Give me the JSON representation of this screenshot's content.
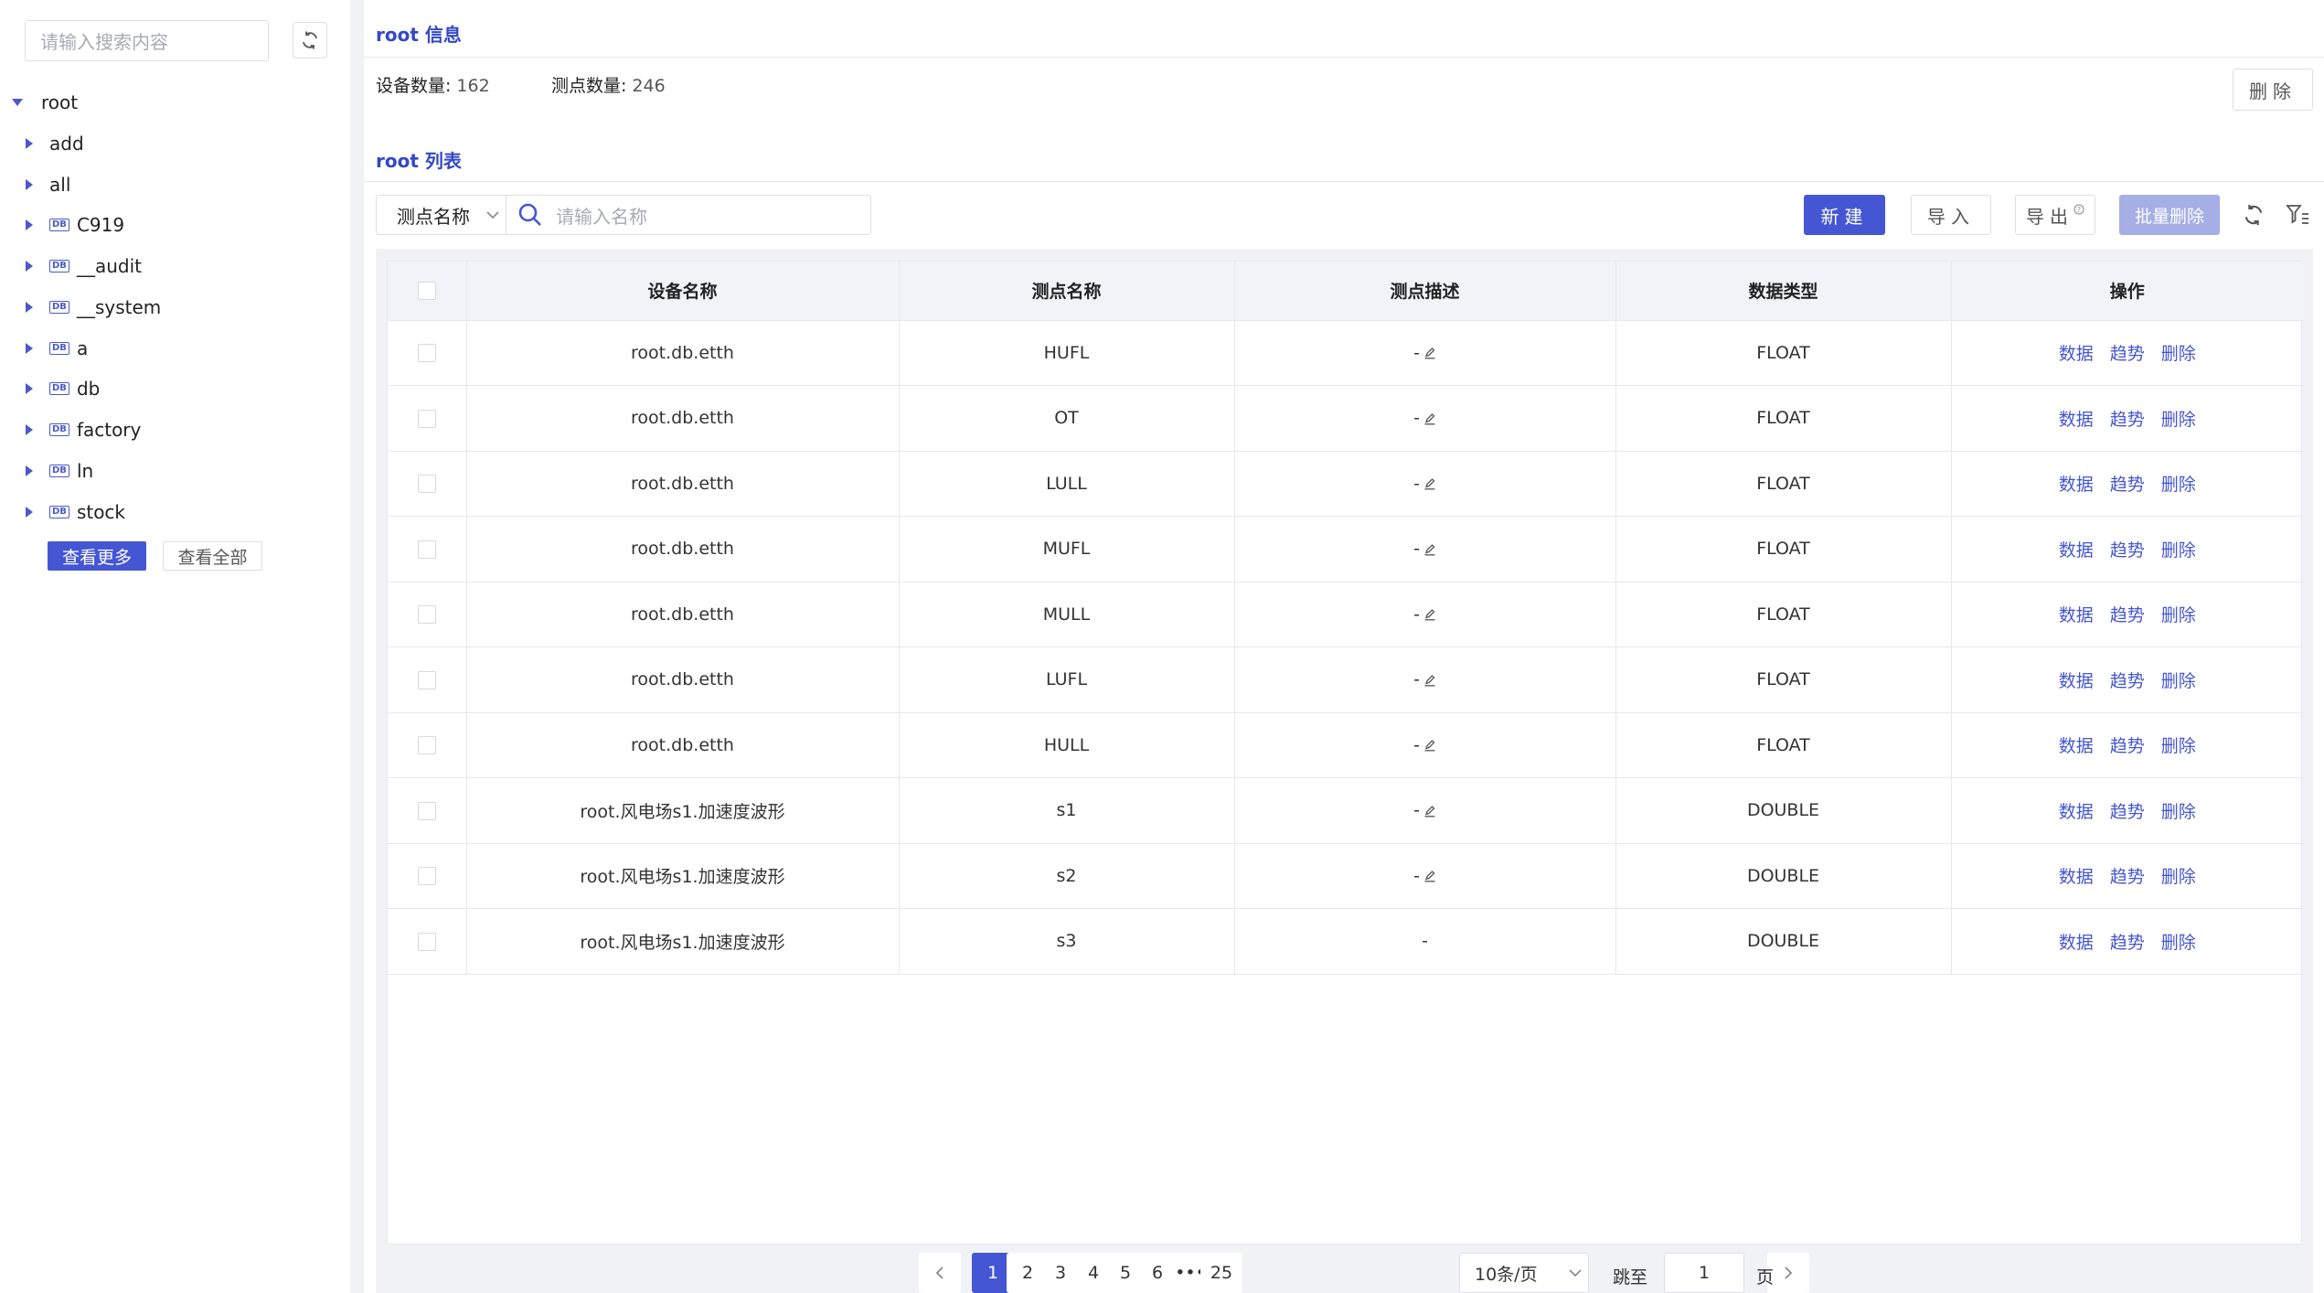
{
  "sidebar": {
    "search_placeholder": "请输入搜索内容",
    "tree": [
      {
        "label": "root",
        "expanded": true,
        "level": 0,
        "db": false
      },
      {
        "label": "add",
        "expanded": false,
        "level": 1,
        "db": false
      },
      {
        "label": "all",
        "expanded": false,
        "level": 1,
        "db": false
      },
      {
        "label": "C919",
        "expanded": false,
        "level": 1,
        "db": true
      },
      {
        "label": "__audit",
        "expanded": false,
        "level": 1,
        "db": true
      },
      {
        "label": "__system",
        "expanded": false,
        "level": 1,
        "db": true
      },
      {
        "label": "a",
        "expanded": false,
        "level": 1,
        "db": true
      },
      {
        "label": "db",
        "expanded": false,
        "level": 1,
        "db": true
      },
      {
        "label": "factory",
        "expanded": false,
        "level": 1,
        "db": true
      },
      {
        "label": "ln",
        "expanded": false,
        "level": 1,
        "db": true
      },
      {
        "label": "stock",
        "expanded": false,
        "level": 1,
        "db": true
      }
    ],
    "db_badge": "DB",
    "more_label": "查看更多",
    "all_label": "查看全部"
  },
  "info": {
    "title": "root 信息",
    "device_label": "设备数量:",
    "device_count": "162",
    "point_label": "测点数量:",
    "point_count": "246",
    "delete_label": "删除"
  },
  "list": {
    "title": "root 列表",
    "filter_select": "测点名称",
    "filter_placeholder": "请输入名称",
    "new_label": "新建",
    "import_label": "导入",
    "export_label": "导出",
    "batch_delete_label": "批量删除",
    "columns": [
      "设备名称",
      "测点名称",
      "测点描述",
      "数据类型",
      "操作"
    ],
    "rows": [
      {
        "device": "root.db.etth",
        "point": "HUFL",
        "desc": "-",
        "type": "FLOAT",
        "editable": true
      },
      {
        "device": "root.db.etth",
        "point": "OT",
        "desc": "-",
        "type": "FLOAT",
        "editable": true
      },
      {
        "device": "root.db.etth",
        "point": "LULL",
        "desc": "-",
        "type": "FLOAT",
        "editable": true
      },
      {
        "device": "root.db.etth",
        "point": "MUFL",
        "desc": "-",
        "type": "FLOAT",
        "editable": true
      },
      {
        "device": "root.db.etth",
        "point": "MULL",
        "desc": "-",
        "type": "FLOAT",
        "editable": true
      },
      {
        "device": "root.db.etth",
        "point": "LUFL",
        "desc": "-",
        "type": "FLOAT",
        "editable": true
      },
      {
        "device": "root.db.etth",
        "point": "HULL",
        "desc": "-",
        "type": "FLOAT",
        "editable": true
      },
      {
        "device": "root.风电场s1.加速度波形",
        "point": "s1",
        "desc": "-",
        "type": "DOUBLE",
        "editable": true
      },
      {
        "device": "root.风电场s1.加速度波形",
        "point": "s2",
        "desc": "-",
        "type": "DOUBLE",
        "editable": true
      },
      {
        "device": "root.风电场s1.加速度波形",
        "point": "s3",
        "desc": "-",
        "type": "DOUBLE",
        "editable": false
      }
    ],
    "actions": [
      "数据",
      "趋势",
      "删除"
    ]
  },
  "pagination": {
    "pages": [
      "1",
      "2",
      "3",
      "4",
      "5",
      "6",
      "•••",
      "25"
    ],
    "current": "1",
    "page_size": "10条/页",
    "jump_label": "跳至",
    "jump_value": "1",
    "page_suffix": "页"
  },
  "colors": {
    "accent": "#4456d3",
    "accent_disabled": "#a5aee5",
    "title": "#3448c5"
  }
}
